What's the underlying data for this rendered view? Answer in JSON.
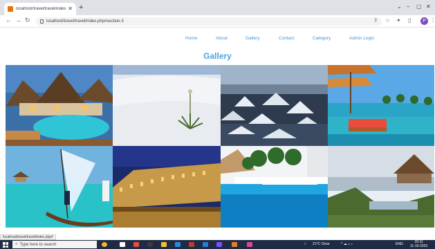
{
  "browser": {
    "tab_title": "localhost/travel/travel/index.php",
    "tab_close": "✕",
    "new_tab": "+",
    "url": "localhost/travel/travel/index.php#section-3",
    "back": "←",
    "forward": "→",
    "reload": "↻",
    "minimize": "–",
    "maximize": "▢",
    "close": "✕",
    "profile_initial": "P"
  },
  "nav": {
    "items": [
      {
        "label": "Home"
      },
      {
        "label": "About"
      },
      {
        "label": "Gallery"
      },
      {
        "label": "Contact"
      },
      {
        "label": "Category"
      },
      {
        "label": "Admin Login"
      }
    ]
  },
  "gallery": {
    "title": "Gallery",
    "images": [
      {
        "name": "resort-huts-pool"
      },
      {
        "name": "white-sand-desert"
      },
      {
        "name": "snowy-town-rooftops"
      },
      {
        "name": "beach-umbrellas-pool"
      },
      {
        "name": "sailboat-turquoise-sea"
      },
      {
        "name": "palace-night-lights"
      },
      {
        "name": "palm-pool-resort"
      },
      {
        "name": "cliffside-infinity-pool"
      }
    ]
  },
  "status": {
    "link_preview": "localhost/travel/travel/index.php#"
  },
  "taskbar": {
    "search_placeholder": "Type here to search",
    "weather": "21°C Clear",
    "lang": "ENG",
    "time": "20:11",
    "date": "11-10-2023"
  }
}
